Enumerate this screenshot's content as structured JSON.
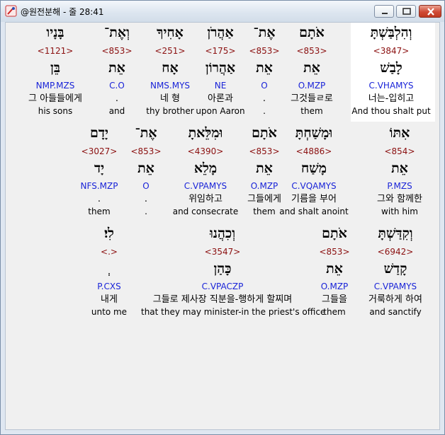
{
  "window": {
    "title": "@원전분해 - 줄 28:41"
  },
  "rows": [
    [
      {
        "hebrew": "וְהִלְבַּשְׁתָּ",
        "strong": "<3847>",
        "lemma": "לָבַשׁ",
        "morph": "C.VHAMYS",
        "korean": "너는-입히고",
        "english": "And thou shalt put",
        "highlighted": true
      },
      {
        "hebrew": "אֹתָם",
        "strong": "<853>",
        "lemma": "אֵת",
        "morph": "O.MZP",
        "korean": "그것들ㄹ로",
        "english": "them"
      },
      {
        "hebrew": "אֶת־",
        "strong": "<853>",
        "lemma": "אֵת",
        "morph": "O",
        "korean": ".",
        "english": "."
      },
      {
        "hebrew": "אַהֲרֹן",
        "strong": "<175>",
        "lemma": "אַהֲרוֹן",
        "morph": "NE",
        "korean": "아론과",
        "english": "upon Aaron"
      },
      {
        "hebrew": "אָחִיךָ",
        "strong": "<251>",
        "lemma": "אָח",
        "morph": "NMS.MYS",
        "korean": "네 형",
        "english": "thy brother"
      },
      {
        "hebrew": "וְאֶת־",
        "strong": "<853>",
        "lemma": "אֵת",
        "morph": "C.O",
        "korean": ".",
        "english": "and"
      },
      {
        "hebrew": "בָּנָיו",
        "strong": "<1121>",
        "lemma": "בֵּן",
        "morph": "NMP.MZS",
        "korean": "그 아들들에게",
        "english": "his sons"
      }
    ],
    [
      {
        "hebrew": "אִתּוֹ",
        "strong": "<854>",
        "lemma": "אֵת",
        "morph": "P.MZS",
        "korean": "그와 함께한",
        "english": "with him"
      },
      {
        "hebrew": "וּמָשַׁחְתָּ",
        "strong": "<4886>",
        "lemma": "מָשַׁח",
        "morph": "C.VQAMYS",
        "korean": "기름을 부어",
        "english": "and shalt anoint"
      },
      {
        "hebrew": "אֹתָם",
        "strong": "<853>",
        "lemma": "אֵת",
        "morph": "O.MZP",
        "korean": "그들에게",
        "english": "them"
      },
      {
        "hebrew": "וּמִלֵּאתָ",
        "strong": "<4390>",
        "lemma": "מָלֵא",
        "morph": "C.VPAMYS",
        "korean": "위임하고",
        "english": "and consecrate"
      },
      {
        "hebrew": "אֶת־",
        "strong": "<853>",
        "lemma": "אֵת",
        "morph": "O",
        "korean": ".",
        "english": "."
      },
      {
        "hebrew": "יָדָם",
        "strong": "<3027>",
        "lemma": "יָד",
        "morph": "NFS.MZP",
        "korean": ".",
        "english": "them"
      }
    ],
    [
      {
        "hebrew": "וְקִדַּשְׁתָּ",
        "strong": "<6942>",
        "lemma": "קָדַשׁ",
        "morph": "C.VPAMYS",
        "korean": "거룩하게 하여",
        "english": "and sanctify"
      },
      {
        "hebrew": "אֹתָם",
        "strong": "<853>",
        "lemma": "אֵת",
        "morph": "O.MZP",
        "korean": "그들을",
        "english": "them"
      },
      {
        "hebrew": "וְכִהֲנוּ",
        "strong": "<3547>",
        "lemma": "כָּהַן",
        "morph": "C.VPACZP",
        "korean": "그들로 제사장 직분을-행하게 할찌며",
        "english": "that they may minister-in the priest's office"
      },
      {
        "hebrew": "לִי׃",
        "strong": "<.>",
        "lemma": "ְ",
        "morph": "P.CXS",
        "korean": "내게",
        "english": "unto me"
      }
    ]
  ]
}
